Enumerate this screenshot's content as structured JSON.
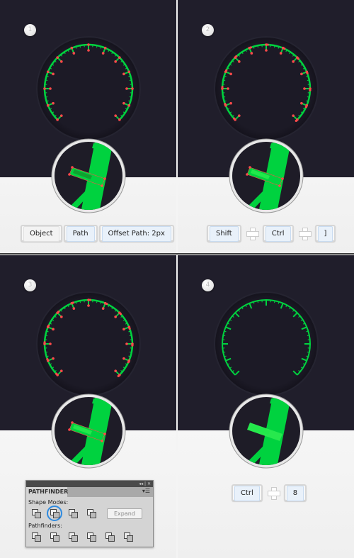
{
  "colors": {
    "panel_bg": "#201e2b",
    "gauge_green": "#00d23f",
    "anchor_red": "#ff4a4a"
  },
  "steps": [
    {
      "number": "1",
      "keys": [
        "Object",
        "Path",
        "Offset Path: 2px"
      ]
    },
    {
      "number": "2",
      "keys": [
        "Shift",
        "Ctrl",
        "]"
      ]
    },
    {
      "number": "3"
    },
    {
      "number": "4",
      "keys": [
        "Ctrl",
        "8"
      ]
    }
  ],
  "pathfinder": {
    "header_controls": "◂◂ | ✕",
    "title": "PATHFINDER",
    "menu_icon": "▾☰",
    "shape_modes_label": "Shape Modes:",
    "expand_label": "Expand",
    "pathfinders_label": "Pathfinders:",
    "selected_shape_mode": "minus-front"
  }
}
